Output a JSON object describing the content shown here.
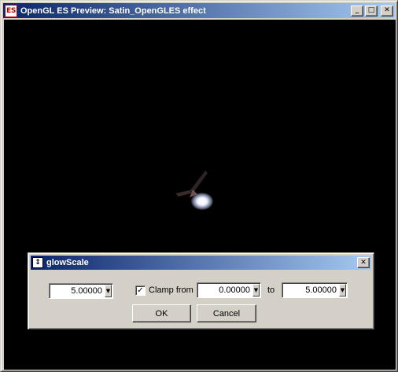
{
  "window": {
    "icon_text": "ES",
    "title": "OpenGL ES Preview: Satin_OpenGLES effect",
    "minimize_glyph": "_",
    "maximize_glyph": "□",
    "close_glyph": "✕"
  },
  "dialog": {
    "icon_glyph": "↕",
    "title": "glowScale",
    "close_glyph": "✕",
    "value": "5.00000",
    "clamp_checked_glyph": "✓",
    "clamp_label": "Clamp from",
    "clamp_min": "0.00000",
    "to_label": "to",
    "clamp_max": "5.00000",
    "dropdown_glyph": "▼",
    "ok_label": "OK",
    "cancel_label": "Cancel"
  }
}
